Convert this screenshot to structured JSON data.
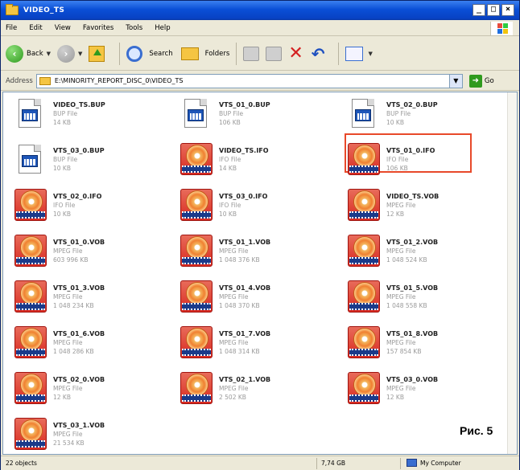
{
  "window": {
    "title": "VIDEO_TS",
    "controls": {
      "minimize": "_",
      "maximize": "□",
      "close": "×"
    }
  },
  "menubar": {
    "items": [
      "File",
      "Edit",
      "View",
      "Favorites",
      "Tools",
      "Help"
    ]
  },
  "toolbar": {
    "back_label": "Back",
    "search_label": "Search",
    "folders_label": "Folders",
    "dropdown_glyph": "▼"
  },
  "address": {
    "label": "Address",
    "value": "E:\\MINORITY_REPORT_DISC_0\\VIDEO_TS",
    "go_label": "Go"
  },
  "files": [
    {
      "name": "VIDEO_TS.BUP",
      "type": "BUP File",
      "size": "14 KB",
      "icon": "bup-file-icon"
    },
    {
      "name": "VTS_01_0.BUP",
      "type": "BUP File",
      "size": "106 KB",
      "icon": "bup-file-icon"
    },
    {
      "name": "VTS_02_0.BUP",
      "type": "BUP File",
      "size": "10 KB",
      "icon": "bup-file-icon"
    },
    {
      "name": "VTS_03_0.BUP",
      "type": "BUP File",
      "size": "10 KB",
      "icon": "bup-file-icon"
    },
    {
      "name": "VIDEO_TS.IFO",
      "type": "IFO File",
      "size": "14 KB",
      "icon": "media-file-icon"
    },
    {
      "name": "VTS_01_0.IFO",
      "type": "IFO File",
      "size": "106 KB",
      "icon": "media-file-icon",
      "selected": true
    },
    {
      "name": "VTS_02_0.IFO",
      "type": "IFO File",
      "size": "10 KB",
      "icon": "media-file-icon"
    },
    {
      "name": "VTS_03_0.IFO",
      "type": "IFO File",
      "size": "10 KB",
      "icon": "media-file-icon"
    },
    {
      "name": "VIDEO_TS.VOB",
      "type": "MPEG File",
      "size": "12 KB",
      "icon": "media-file-icon"
    },
    {
      "name": "VTS_01_0.VOB",
      "type": "MPEG File",
      "size": "603 996 KB",
      "icon": "media-file-icon"
    },
    {
      "name": "VTS_01_1.VOB",
      "type": "MPEG File",
      "size": "1 048 376 KB",
      "icon": "media-file-icon"
    },
    {
      "name": "VTS_01_2.VOB",
      "type": "MPEG File",
      "size": "1 048 524 KB",
      "icon": "media-file-icon"
    },
    {
      "name": "VTS_01_3.VOB",
      "type": "MPEG File",
      "size": "1 048 234 KB",
      "icon": "media-file-icon"
    },
    {
      "name": "VTS_01_4.VOB",
      "type": "MPEG File",
      "size": "1 048 370 KB",
      "icon": "media-file-icon"
    },
    {
      "name": "VTS_01_5.VOB",
      "type": "MPEG File",
      "size": "1 048 558 KB",
      "icon": "media-file-icon"
    },
    {
      "name": "VTS_01_6.VOB",
      "type": "MPEG File",
      "size": "1 048 286 KB",
      "icon": "media-file-icon"
    },
    {
      "name": "VTS_01_7.VOB",
      "type": "MPEG File",
      "size": "1 048 314 KB",
      "icon": "media-file-icon"
    },
    {
      "name": "VTS_01_8.VOB",
      "type": "MPEG File",
      "size": "157 854 KB",
      "icon": "media-file-icon"
    },
    {
      "name": "VTS_02_0.VOB",
      "type": "MPEG File",
      "size": "12 KB",
      "icon": "media-file-icon"
    },
    {
      "name": "VTS_02_1.VOB",
      "type": "MPEG File",
      "size": "2 502 KB",
      "icon": "media-file-icon"
    },
    {
      "name": "VTS_03_0.VOB",
      "type": "MPEG File",
      "size": "12 KB",
      "icon": "media-file-icon"
    },
    {
      "name": "VTS_03_1.VOB",
      "type": "MPEG File",
      "size": "21 534 KB",
      "icon": "media-file-icon"
    }
  ],
  "caption": "Рис. 5",
  "statusbar": {
    "count": "22 objects",
    "size": "7,74 GB",
    "location": "My Computer"
  },
  "colors": {
    "titlebar": "#0a4fd6",
    "highlight": "#e8492a",
    "media_icon": "#d92a20"
  }
}
